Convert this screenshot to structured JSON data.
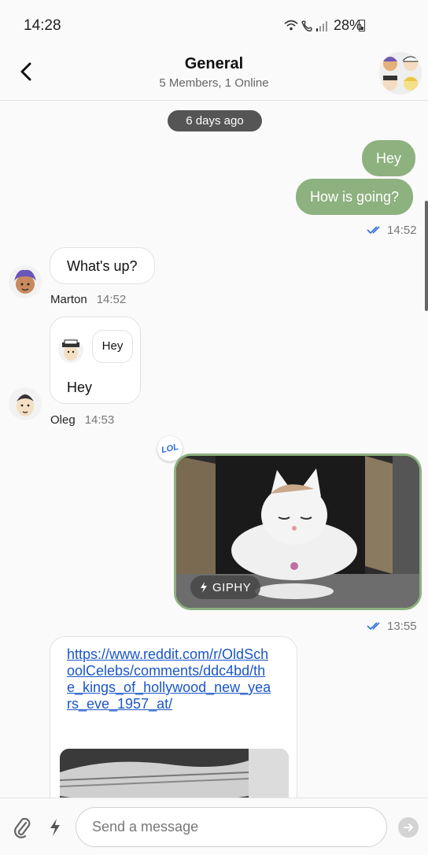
{
  "status_bar": {
    "time": "14:28",
    "battery": "28%",
    "signal_icons": "wifi-call-signal-icons"
  },
  "header": {
    "title": "General",
    "subtitle": "5 Members, 1 Online"
  },
  "date_separator": "6 days ago",
  "messages": {
    "m1": {
      "text": "Hey"
    },
    "m2": {
      "text": "How is going?"
    },
    "m2_time": "14:52",
    "m3": {
      "text": "What's up?",
      "author": "Marton",
      "time": "14:52"
    },
    "m4": {
      "text": "Hey",
      "quoted_text": "Hey",
      "author": "Oleg",
      "time": "14:53"
    },
    "m5": {
      "reaction": "LOL",
      "badge": "GIPHY",
      "time": "13:55"
    },
    "m6": {
      "link": "https://www.reddit.com/r/OldSchoolCelebs/comments/ddc4bd/the_kings_of_hollywood_new_years_eve_1957_at/"
    }
  },
  "link_display": "https://www.reddit.com/r/OldSchoolCelebs/comments/ddc4bd/the_kings_of_hollywood_new_years_eve_1957_at/",
  "composer": {
    "placeholder": "Send a message"
  },
  "colors": {
    "mine_bubble": "#8db17f",
    "link": "#1a56c8",
    "ticks": "#2d6fd6"
  }
}
